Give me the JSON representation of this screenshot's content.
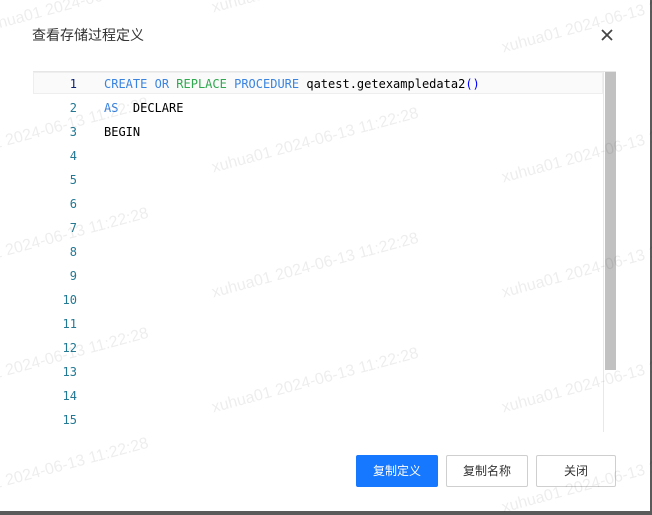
{
  "dialog": {
    "title": "查看存储过程定义",
    "close_icon": "close-icon"
  },
  "editor": {
    "line_numbers": [
      "1",
      "2",
      "3",
      "4",
      "5",
      "6",
      "7",
      "8",
      "9",
      "10",
      "11",
      "12",
      "13",
      "14",
      "15"
    ],
    "line1": {
      "create": "CREATE",
      "or": "OR",
      "replace": "REPLACE",
      "procedure": "PROCEDURE",
      "name": "qatest.getexampledata2",
      "paren": "()"
    },
    "line2": {
      "as": "AS",
      "declare": "DECLARE"
    },
    "line3": {
      "begin": "BEGIN"
    }
  },
  "buttons": {
    "copy_definition": "复制定义",
    "copy_name": "复制名称",
    "close": "关闭"
  },
  "watermark": {
    "text": "xuhua01 2024-06-13 11:22:28"
  },
  "colors": {
    "primary": "#1677ff",
    "line_number": "#237893",
    "keyword_blue": "#3a84e0",
    "keyword_green": "#2fa84f"
  }
}
